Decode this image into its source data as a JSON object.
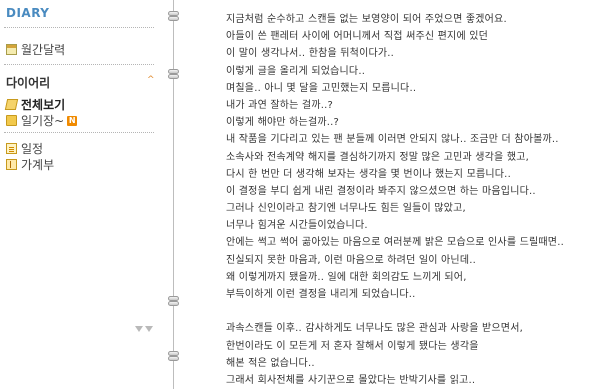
{
  "sidebar": {
    "title": "DIARY",
    "calendar": "월간달력",
    "section_title": "다이어리",
    "collapse_glyph": "^",
    "view_all": "전체보기",
    "diary_folder": "일기장~",
    "new_badge": "N",
    "schedule": "일정",
    "ledger": "가계부"
  },
  "content": {
    "lines": [
      "지금처럼 순수하고 스캔들 없는 보영양이 되어 주었으면 좋겠어요.",
      "아들이 쓴 팬레터 사이에 어머니께서 직접 써주신 편지에 있던",
      "이 말이 생각나서.. 한참을 뒤척이다가..",
      "이렇게 글을 올리게 되었습니다..",
      "며칠을.. 아니 몇 달을 고민했는지 모릅니다..",
      "내가 과연 잘하는 걸까..?",
      "이렇게 해야만 하는걸까..?",
      "내 작품을 기다리고 있는 팬 분들께 이러면 안되지 않나.. 조금만 더 참아볼까..",
      "소속사와 전속계약 해지를 결심하기까지 정말 많은 고민과 생각을 했고,",
      "다시 한 번만 더 생각해 보자는 생각을 몇 번이나 했는지 모릅니다..",
      "이 결정을 부디 쉽게 내린 결정이라 봐주지 않으셨으면 하는 마음입니다..",
      "그러나 신인이라고 참기엔 너무나도 힘든 일들이 많았고,",
      "너무나 힘겨운 시간들이었습니다.",
      "안에는 썩고 썩어 곪아있는 마음으로 여러분께 밝은 모습으로 인사를 드릴때면..",
      "진실되지 못한 마음과, 이런 마음으로 하려던 일이 아닌데..",
      "왜 이렇게까지 됐을까.. 일에 대한 회의감도 느끼게 되어,",
      "부득이하게 이런 결정을 내리게 되었습니다..",
      "",
      "과속스캔들 이후.. 감사하게도 너무나도 많은 관심과 사랑을 받으면서,",
      "한번이라도 이 모든게 저 혼자 잘해서 이렇게 됐다는 생각을",
      "해본 적은 없습니다..",
      "그래서 회사전체를 사기꾼으로 몰았다는 반박기사를 읽고.."
    ]
  },
  "colors": {
    "title_blue": "#4a8bc0",
    "arrow_orange": "#e08a2e",
    "badge_orange": "#f08a00"
  }
}
